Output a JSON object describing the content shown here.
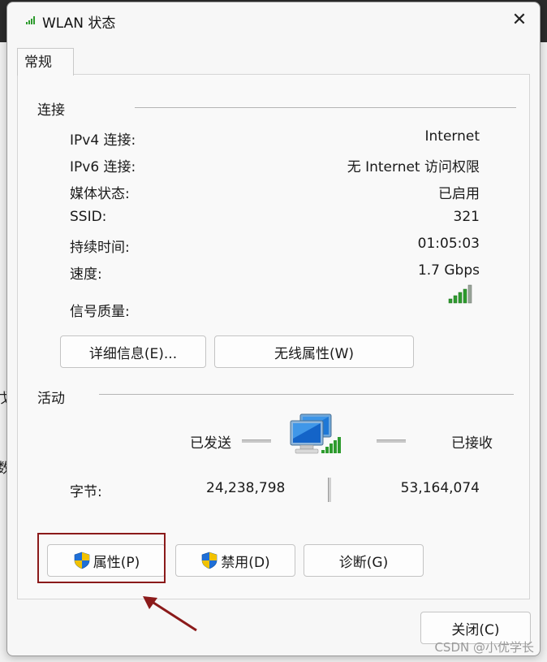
{
  "window": {
    "title": "WLAN 状态",
    "close_label": "✕"
  },
  "tabs": [
    {
      "label": "常规"
    }
  ],
  "connection": {
    "title": "连接",
    "rows": [
      {
        "label": "IPv4 连接:",
        "value": "Internet"
      },
      {
        "label": "IPv6 连接:",
        "value": "无 Internet 访问权限"
      },
      {
        "label": "媒体状态:",
        "value": "已启用"
      },
      {
        "label": "SSID:",
        "value": "321"
      },
      {
        "label": "持续时间:",
        "value": "01:05:03"
      },
      {
        "label": "速度:",
        "value": "1.7 Gbps"
      }
    ],
    "signal_label": "信号质量:",
    "signal_bars": 5,
    "details_button": "详细信息(E)...",
    "wireless_button": "无线属性(W)"
  },
  "activity": {
    "title": "活动",
    "sent_label": "已发送",
    "received_label": "已接收",
    "bytes_label": "字节:",
    "bytes_sent": "24,238,798",
    "bytes_received": "53,164,074"
  },
  "actions": {
    "properties": "属性(P)",
    "disable": "禁用(D)",
    "diagnose": "诊断(G)"
  },
  "footer": {
    "close_button": "关闭(C)"
  },
  "background": {
    "fragment_1": "戊",
    "fragment_2": "数"
  },
  "watermark": "CSDN @小优学长",
  "colors": {
    "highlight": "#8b1a1a",
    "signal_green": "#2e9b2e",
    "shield_blue": "#1f6fd6",
    "shield_yellow": "#f2c200"
  },
  "icons": [
    "wifi-signal-icon",
    "close-icon",
    "shield-icon",
    "network-computers-icon",
    "annotation-arrow"
  ]
}
